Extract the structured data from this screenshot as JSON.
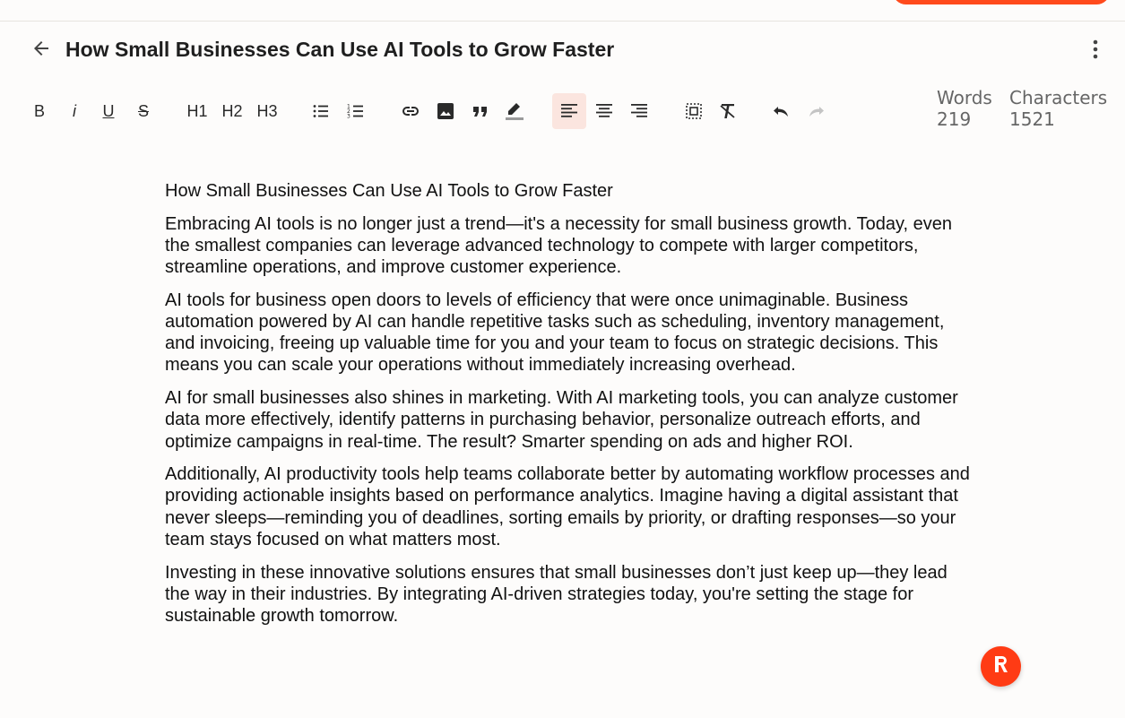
{
  "header": {
    "title": "How Small Businesses Can Use AI Tools to Grow Faster"
  },
  "toolbar": {
    "bold": "B",
    "italic": "i",
    "underline": "U",
    "strike": "S",
    "h1": "H1",
    "h2": "H2",
    "h3": "H3",
    "icons": [
      "bullet-list-icon",
      "numbered-list-icon",
      "link-icon",
      "image-icon",
      "quote-icon",
      "highlight-icon",
      "align-left-icon",
      "align-center-icon",
      "align-right-icon",
      "select-all-icon",
      "clear-format-icon",
      "undo-icon",
      "redo-icon"
    ],
    "active_alignment": "left",
    "accent": "#ff4a1c",
    "active_bg": "#fbe5df"
  },
  "stats": {
    "words_label": "Words",
    "words_value": "219",
    "chars_label": "Characters",
    "chars_value": "1521"
  },
  "content": {
    "paragraphs": [
      "How Small Businesses Can Use AI Tools to Grow Faster",
      "Embracing AI tools is no longer just a trend—it's a necessity for small business growth. Today, even the smallest companies can leverage advanced technology to compete with larger competitors, streamline operations, and improve customer experience.",
      "AI tools for business open doors to levels of efficiency that were once unimaginable. Business automation powered by AI can handle repetitive tasks such as scheduling, inventory management, and invoicing, freeing up valuable time for you and your team to focus on strategic decisions. This means you can scale your operations without immediately increasing overhead.",
      "AI for small businesses also shines in marketing. With AI marketing tools, you can analyze customer data more effectively, identify patterns in purchasing behavior, personalize outreach efforts, and optimize campaigns in real-time. The result? Smarter spending on ads and higher ROI.",
      "Additionally, AI productivity tools help teams collaborate better by automating workflow processes and providing actionable insights based on performance analytics. Imagine having a digital assistant that never sleeps—reminding you of deadlines, sorting emails by priority, or drafting responses—so your team stays focused on what matters most.",
      "Investing in these innovative solutions ensures that small businesses don’t just keep up—they lead the way in their industries. By integrating AI-driven strategies today, you're setting the stage for sustainable growth tomorrow."
    ]
  },
  "fab": {
    "brand_color": "#ff3b14",
    "icon": "r-logo-icon"
  }
}
